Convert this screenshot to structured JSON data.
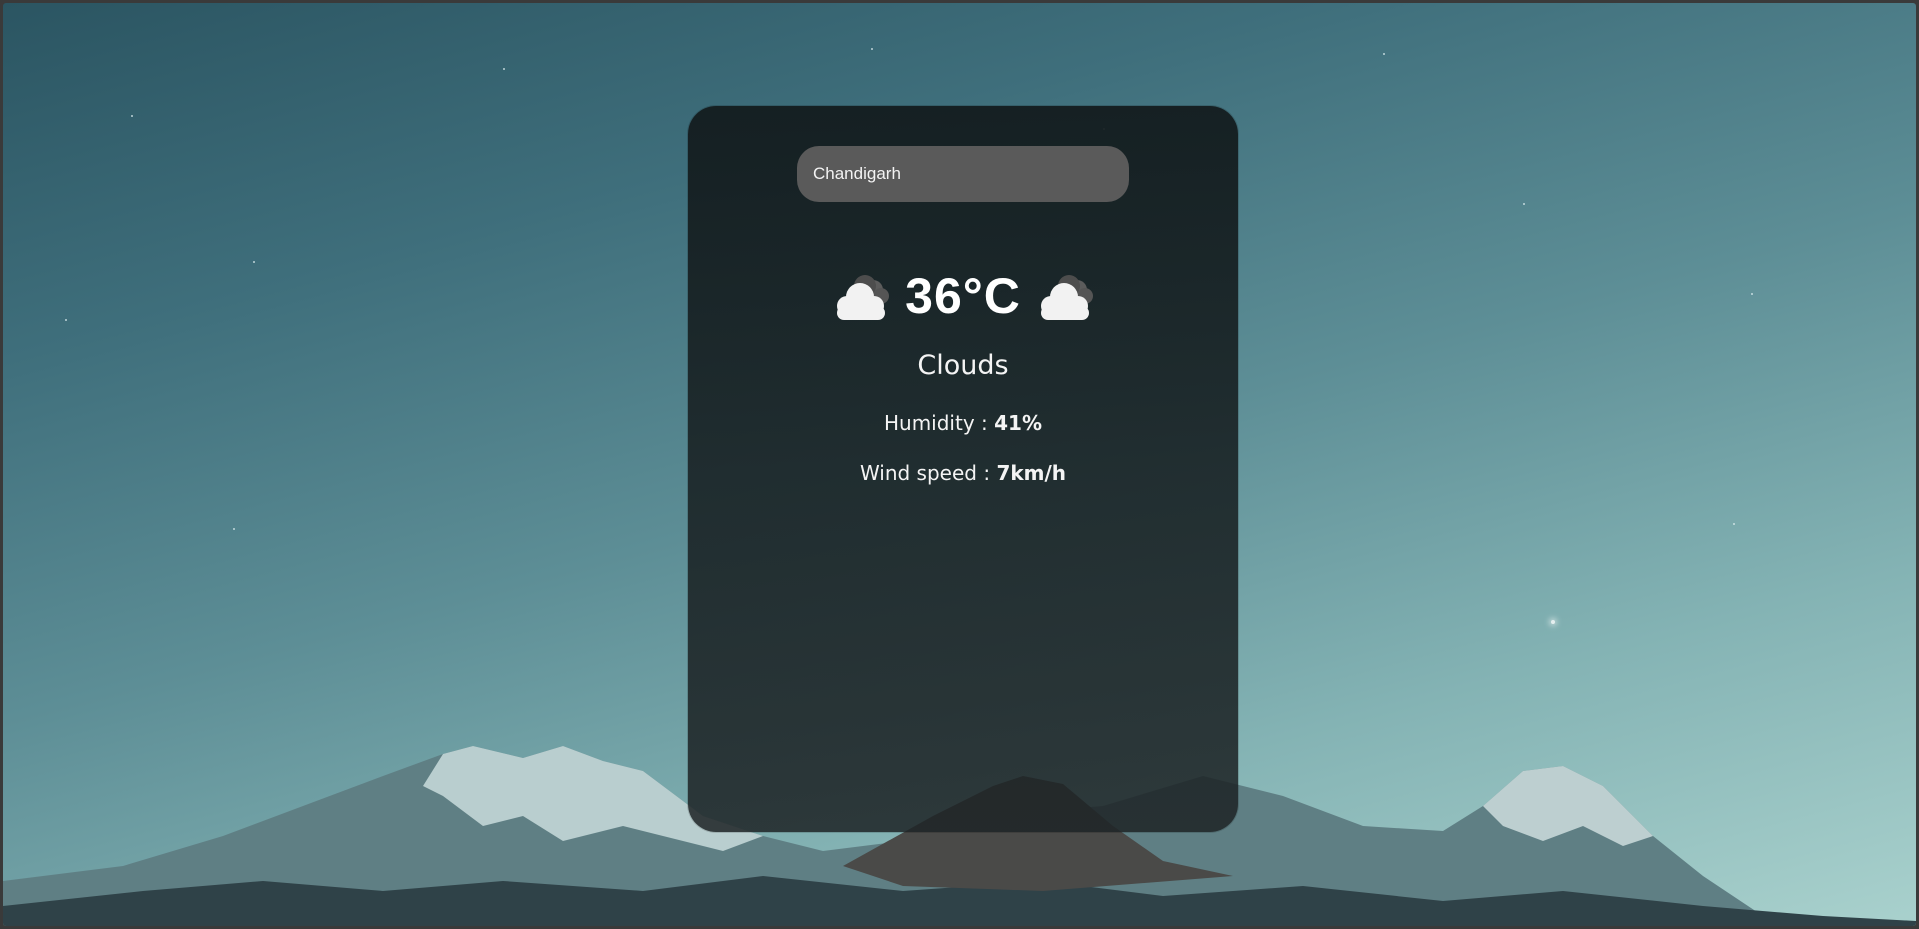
{
  "search": {
    "value": "Chandigarh"
  },
  "weather": {
    "temperature": "36°C",
    "condition": "Clouds",
    "icon": "cloudy-icon",
    "humidity_label": "Humidity : ",
    "humidity_value": "41%",
    "wind_label": "Wind speed : ",
    "wind_value": "7km/h"
  }
}
